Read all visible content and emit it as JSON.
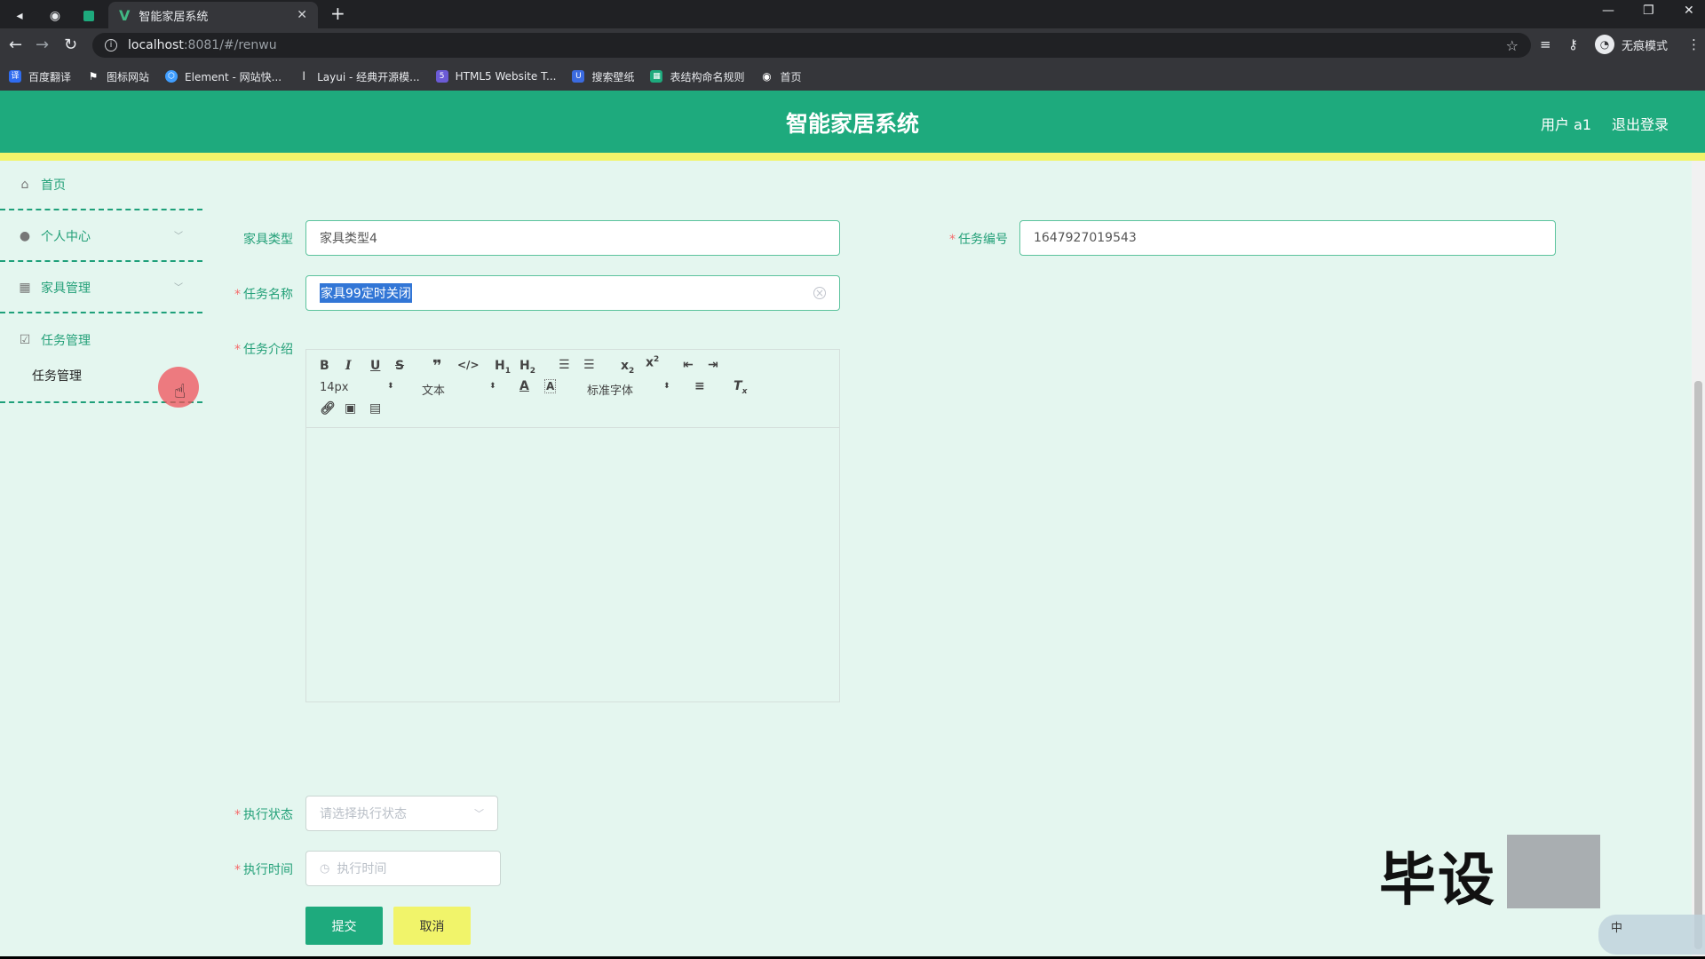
{
  "browser": {
    "tab_title": "智能家居系统",
    "url_host": "localhost",
    "url_rest": ":8081/#/renwu",
    "incognito_label": "无痕模式",
    "bookmarks": [
      {
        "label": "百度翻译",
        "icon": "translate-icon",
        "color": "#2f6cf0"
      },
      {
        "label": "图标网站",
        "icon": "flag-icon",
        "color": "#35363a"
      },
      {
        "label": "Element - 网站快...",
        "icon": "element-icon",
        "color": "#409eff"
      },
      {
        "label": "Layui - 经典开源模...",
        "icon": "layui-icon",
        "color": "#35363a"
      },
      {
        "label": "HTML5 Website T...",
        "icon": "html5-icon",
        "color": "#6b5bd6"
      },
      {
        "label": "搜索壁纸",
        "icon": "wallpaper-icon",
        "color": "#3b6be0"
      },
      {
        "label": "表结构命名规则",
        "icon": "table-icon",
        "color": "#1eaa7d"
      },
      {
        "label": "首页",
        "icon": "globe-icon",
        "color": "#35363a"
      }
    ]
  },
  "header": {
    "title": "智能家居系统",
    "user": "用户 a1",
    "logout": "退出登录"
  },
  "sidebar": {
    "items": [
      {
        "label": "首页",
        "icon": "home-icon"
      },
      {
        "label": "个人中心",
        "icon": "user-icon"
      },
      {
        "label": "家具管理",
        "icon": "grid-icon"
      },
      {
        "label": "任务管理",
        "icon": "checkbox-icon"
      }
    ],
    "sub_item": "任务管理"
  },
  "form": {
    "furniture_type_label": "家具类型",
    "furniture_type_value": "家具类型4",
    "task_no_label": "任务编号",
    "task_no_value": "1647927019543",
    "task_name_label": "任务名称",
    "task_name_value": "家具99定时关闭",
    "task_intro_label": "任务介绍",
    "exec_status_label": "执行状态",
    "exec_status_placeholder": "请选择执行状态",
    "exec_time_label": "执行时间",
    "exec_time_placeholder": "执行时间",
    "submit": "提交",
    "cancel": "取消"
  },
  "editor": {
    "font_size": "14px",
    "text_style": "文本",
    "font_family": "标准字体"
  },
  "overlay": {
    "watermark": "毕设",
    "ime": "中"
  },
  "colors": {
    "primary": "#1eaa7d",
    "accent_yellow": "#f1f46a",
    "background": "#e4f6ef"
  }
}
